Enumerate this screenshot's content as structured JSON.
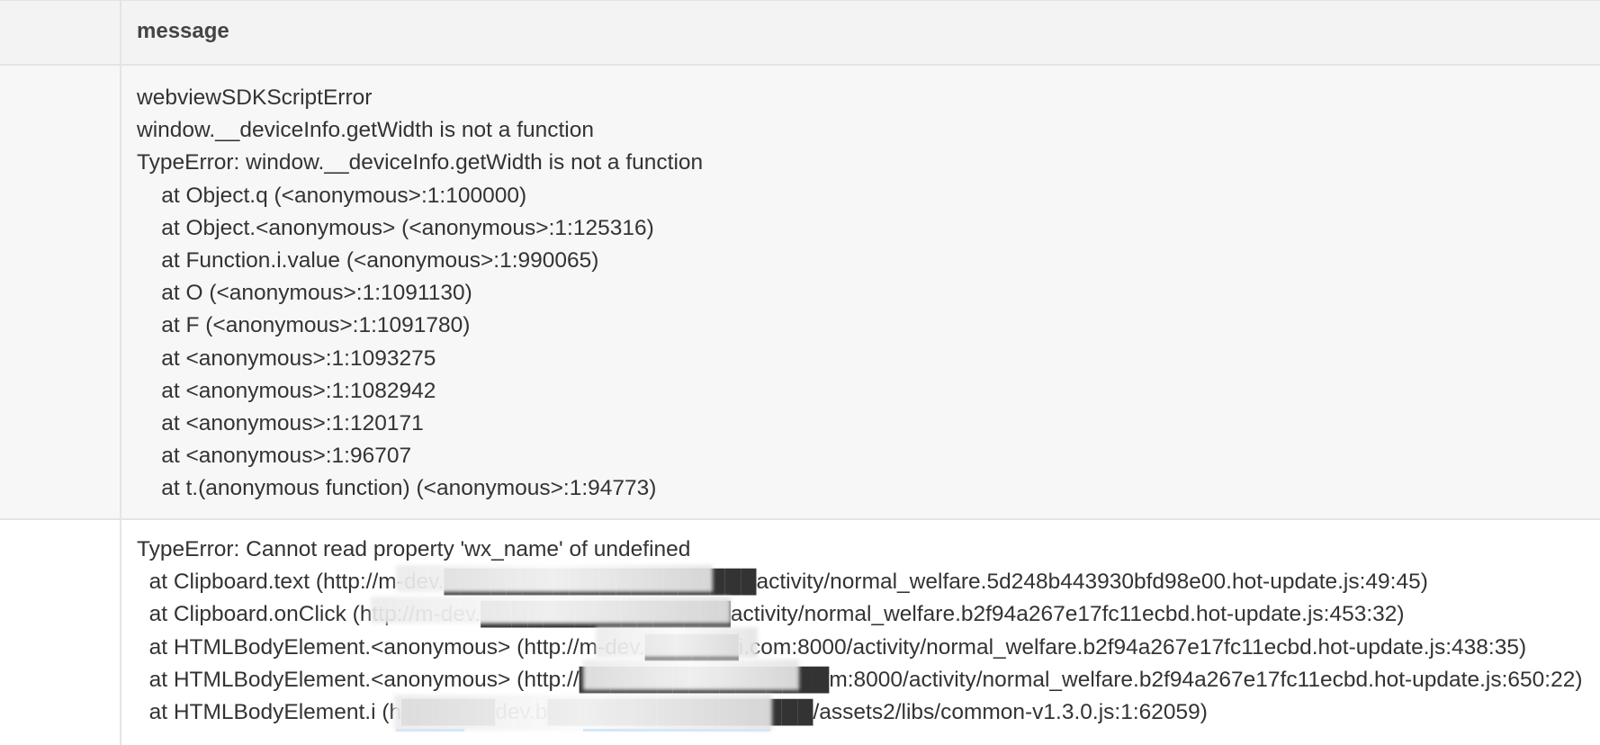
{
  "header": {
    "message_label": "message"
  },
  "rows": [
    {
      "lines": [
        "webviewSDKScriptError",
        "window.__deviceInfo.getWidth is not a function",
        "TypeError: window.__deviceInfo.getWidth is not a function",
        "    at Object.q (<anonymous>:1:100000)",
        "    at Object.<anonymous> (<anonymous>:1:125316)",
        "    at Function.i.value (<anonymous>:1:990065)",
        "    at O (<anonymous>:1:1091130)",
        "    at F (<anonymous>:1:1091780)",
        "    at <anonymous>:1:1093275",
        "    at <anonymous>:1:1082942",
        "    at <anonymous>:1:120171",
        "    at <anonymous>:1:96707",
        "    at t.(anonymous function) (<anonymous>:1:94773)"
      ]
    },
    {
      "lines": [
        "TypeError: Cannot read property 'wx_name' of undefined",
        "  at Clipboard.text (http://m-dev.████████████████████activity/normal_welfare.5d248b443930bfd98e00.hot-update.js:49:45)",
        "  at Clipboard.onClick (http://m-dev.████████████████activity/normal_welfare.b2f94a267e17fc11ecbd.hot-update.js:453:32)",
        "  at HTMLBodyElement.<anonymous> (http://m-dev.██████i.com:8000/activity/normal_welfare.b2f94a267e17fc11ecbd.hot-update.js:438:35)",
        "  at HTMLBodyElement.<anonymous> (http://████████████████m:8000/activity/normal_welfare.b2f94a267e17fc11ecbd.hot-update.js:650:22)",
        "  at HTMLBodyElement.i (h██████dev.b█████████████████/assets2/libs/common-v1.3.0.js:1:62059)"
      ]
    }
  ]
}
